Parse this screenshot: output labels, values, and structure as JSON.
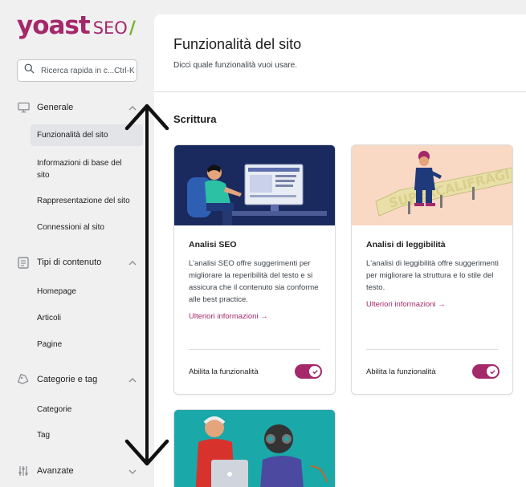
{
  "logo": {
    "brand": "yoast",
    "product": "SEO",
    "slash": "/"
  },
  "search": {
    "placeholder": "Ricerca rapida in c...Ctrl-K"
  },
  "sidebar": {
    "groups": [
      {
        "label": "Generale",
        "icon": "desktop-icon",
        "expanded": true,
        "items": [
          {
            "label": "Funzionalità del sito",
            "active": true
          },
          {
            "label": "Informazioni di base del sito"
          },
          {
            "label": "Rappresentazione del sito"
          },
          {
            "label": "Connessioni al sito"
          }
        ]
      },
      {
        "label": "Tipi di contenuto",
        "icon": "document-icon",
        "expanded": true,
        "items": [
          {
            "label": "Homepage"
          },
          {
            "label": "Articoli"
          },
          {
            "label": "Pagine"
          }
        ]
      },
      {
        "label": "Categorie e tag",
        "icon": "tag-icon",
        "expanded": true,
        "items": [
          {
            "label": "Categorie"
          },
          {
            "label": "Tag"
          }
        ]
      },
      {
        "label": "Avanzate",
        "icon": "sliders-icon",
        "expanded": false,
        "items": []
      }
    ]
  },
  "main": {
    "title": "Funzionalità del sito",
    "subtitle": "Dicci quale funzionalità vuoi usare.",
    "section_title": "Scrittura",
    "cards": [
      {
        "title": "Analisi SEO",
        "description": "L'analisi SEO offre suggerimenti per migliorare la reperibilità del testo e si assicura che il contenuto sia conforme alle best practice.",
        "link": "Ulteriori informazioni →",
        "toggle_label": "Abilita la funzionalità",
        "enabled": true
      },
      {
        "title": "Analisi di leggibilità",
        "description": "L'analisi di leggibilità offre suggerimenti per migliorare la struttura e lo stile del testo.",
        "link": "Ulteriori informazioni →",
        "toggle_label": "Abilita la funzionalità",
        "enabled": true
      }
    ]
  },
  "colors": {
    "brand": "#a4286a",
    "accent_green": "#77b227",
    "card1_bg": "#1a2a5e",
    "card2_bg": "#f9d8c4",
    "card3_bg": "#1aa8a8"
  }
}
